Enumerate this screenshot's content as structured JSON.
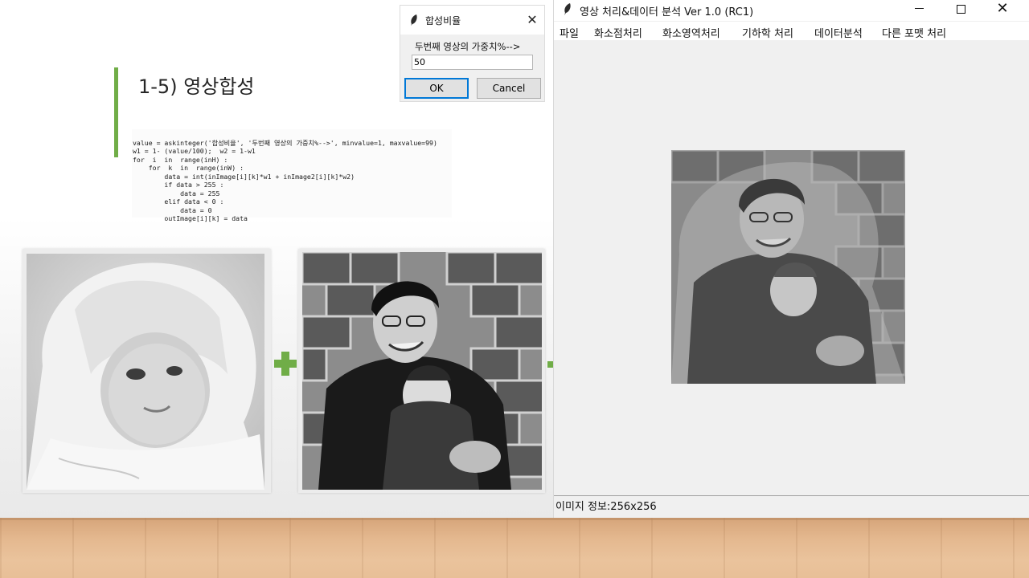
{
  "slide": {
    "title": "1-5) 영상합성",
    "code_lines": [
      "value = askinteger('합성비율', '두번째 영상의 가중치%-->', minvalue=1, maxvalue=99)",
      "w1 = 1- (value/100);  w2 = 1-w1",
      "for  i  in  range(inH) :",
      "    for  k  in  range(inW) :",
      "        data = int(inImage[i][k]*w1 + inImage2[i][k]*w2)",
      "        if data > 255 :",
      "            data = 255",
      "        elif data < 0 :",
      "            data = 0",
      "        outImage[i][k] = data"
    ],
    "accent_color": "#70ad47"
  },
  "dialog": {
    "title": "합성비율",
    "prompt": "두번째 영상의 가중치%-->",
    "input_value": "50",
    "ok_label": "OK",
    "cancel_label": "Cancel",
    "close_icon": "close-icon"
  },
  "app": {
    "title": "영상 처리&데이터 분석 Ver 1.0 (RC1)",
    "menu": [
      "파일",
      "화소점처리",
      "화소영역처리",
      "기하학 처리",
      "데이터분석",
      "다른 포맷 처리"
    ],
    "status": "이미지 정보:256x256",
    "window_buttons": {
      "minimize": "minimize-icon",
      "maximize": "maximize-icon",
      "close": "close-icon"
    }
  }
}
